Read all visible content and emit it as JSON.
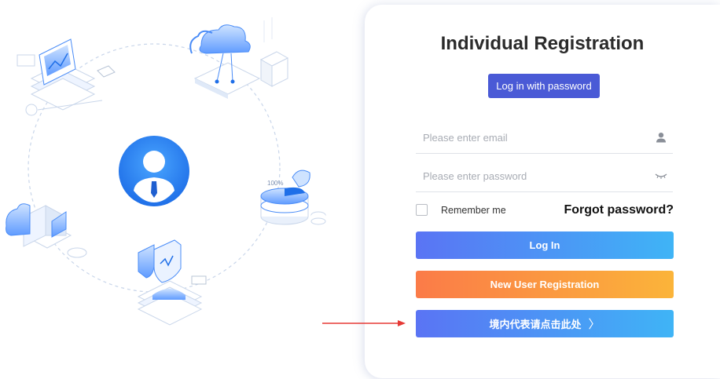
{
  "form": {
    "title": "Individual Registration",
    "password_login_label": "Log in with password",
    "email_placeholder": "Please enter email",
    "password_placeholder": "Please enter password",
    "remember_label": "Remember me",
    "remember_checked": false,
    "forgot_label": "Forgot password?",
    "login_label": "Log In",
    "register_label": "New User Registration",
    "domestic_label": "境内代表请点击此处",
    "domestic_chevron": "〉"
  },
  "illustration": {
    "center_icon": "user-avatar-icon",
    "storage_percent_label": "100%"
  },
  "colors": {
    "primary": "#4a5ad6",
    "login_gradient": [
      "#5a74f4",
      "#3fb4f6"
    ],
    "register_gradient": [
      "#fb7b48",
      "#fbb43a"
    ],
    "arrow": "#e53935"
  }
}
